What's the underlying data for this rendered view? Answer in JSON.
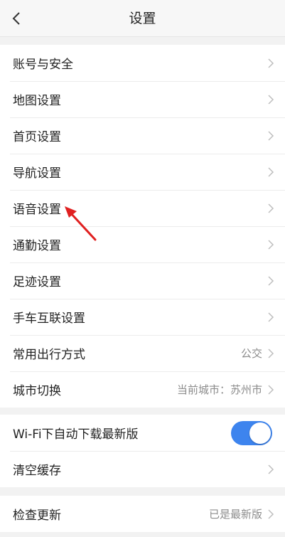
{
  "header": {
    "title": "设置"
  },
  "groups": [
    {
      "items": [
        {
          "label": "账号与安全"
        },
        {
          "label": "地图设置"
        },
        {
          "label": "首页设置"
        },
        {
          "label": "导航设置"
        },
        {
          "label": "语音设置"
        },
        {
          "label": "通勤设置"
        },
        {
          "label": "足迹设置"
        },
        {
          "label": "手车互联设置"
        },
        {
          "label": "常用出行方式",
          "value": "公交"
        },
        {
          "label": "城市切换",
          "value": "当前城市：苏州市"
        }
      ]
    },
    {
      "items": [
        {
          "label": "Wi-Fi下自动下载最新版",
          "toggle": true
        },
        {
          "label": "清空缓存"
        }
      ]
    },
    {
      "items": [
        {
          "label": "检查更新",
          "value": "已是最新版"
        }
      ]
    }
  ],
  "colors": {
    "toggle_on": "#3d84ee",
    "annotation_arrow": "#e02020"
  },
  "icons": {
    "back": "chevron-left-icon",
    "row": "chevron-right-icon"
  }
}
